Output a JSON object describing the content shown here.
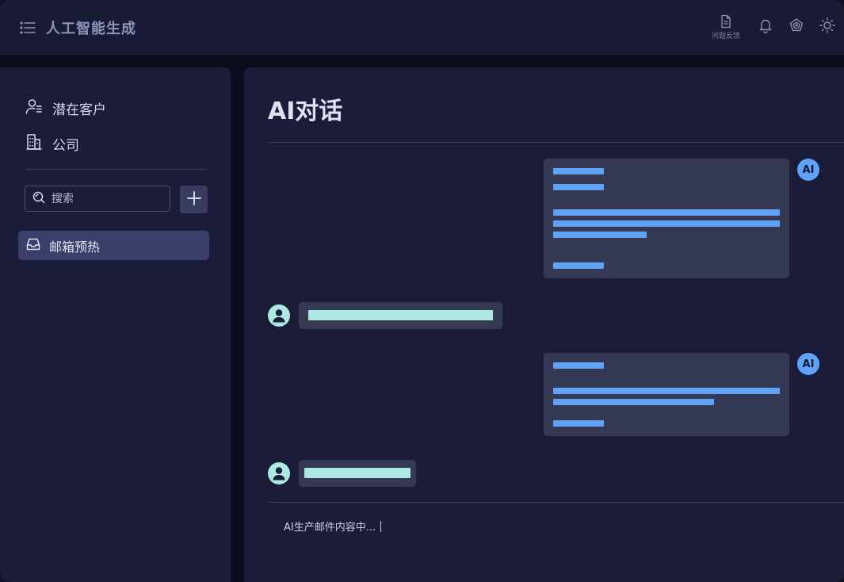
{
  "header": {
    "title": "人工智能生成",
    "feedback_label": "问题反馈",
    "icons": [
      "menu-icon",
      "document-icon",
      "bell-icon",
      "theme-icon",
      "sun-icon"
    ]
  },
  "sidebar": {
    "nav": [
      {
        "label": "潜在客户",
        "icon": "user-list-icon"
      },
      {
        "label": "公司",
        "icon": "building-icon"
      }
    ],
    "search": {
      "placeholder": "搜索"
    },
    "conversations": [
      {
        "label": "邮箱预热",
        "icon": "inbox-icon"
      }
    ]
  },
  "main": {
    "title": "AI对话",
    "ai_avatar_label": "AI",
    "status_text": "AI生产邮件内容中..."
  },
  "colors": {
    "background": "#0b0c1c",
    "panel": "#1a1c3a",
    "topbar": "#181a36",
    "bubble": "#363954",
    "ai_accent": "#5ea3f7",
    "user_accent": "#ade9e2",
    "selected": "#3c3f6a"
  }
}
